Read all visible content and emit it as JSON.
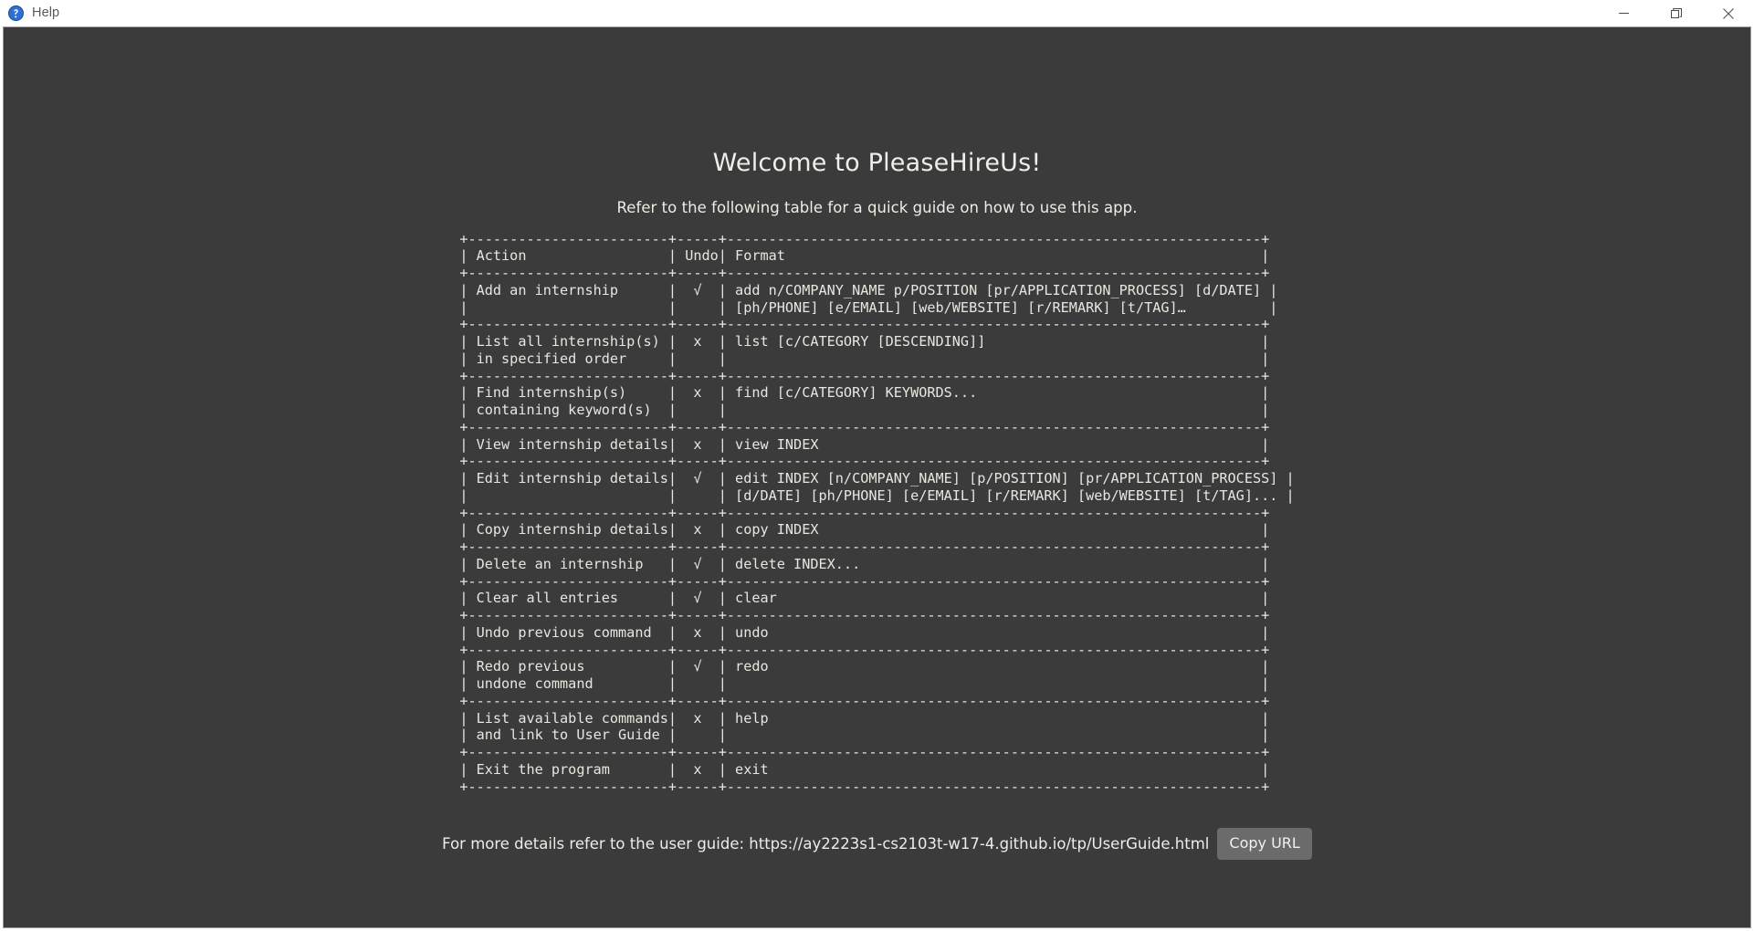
{
  "window": {
    "title": "Help",
    "icon": "help-question-icon",
    "controls": {
      "minimize_label": "Minimize",
      "maximize_label": "Restore",
      "close_label": "Close"
    }
  },
  "help": {
    "title": "Welcome to PleaseHireUs!",
    "subtitle": "Refer to the following table for a quick guide on how to use this app.",
    "footer_text": "For more details refer to the user guide: https://ay2223s1-cs2103t-w17-4.github.io/tp/UserGuide.html",
    "user_guide_url": "https://ay2223s1-cs2103t-w17-4.github.io/tp/UserGuide.html",
    "copy_url_label": "Copy URL"
  },
  "table": {
    "columns": [
      "Action",
      "Undo",
      "Format"
    ],
    "undo_yes_symbol": "√",
    "undo_no_symbol": "x",
    "rows": [
      {
        "action": [
          "Add an internship",
          ""
        ],
        "undo": "√",
        "format": [
          "add n/COMPANY_NAME p/POSITION [pr/APPLICATION_PROCESS] [d/DATE]",
          "[ph/PHONE] [e/EMAIL] [web/WEBSITE] [r/REMARK] [t/TAG]…"
        ]
      },
      {
        "action": [
          "List all internship(s)",
          "in specified order"
        ],
        "undo": "x",
        "format": [
          "list [c/CATEGORY [DESCENDING]]",
          ""
        ]
      },
      {
        "action": [
          "Find internship(s)",
          "containing keyword(s)"
        ],
        "undo": "x",
        "format": [
          "find [c/CATEGORY] KEYWORDS...",
          ""
        ]
      },
      {
        "action": [
          "View internship details"
        ],
        "undo": "x",
        "format": [
          "view INDEX"
        ]
      },
      {
        "action": [
          "Edit internship details",
          ""
        ],
        "undo": "√",
        "format": [
          "edit INDEX [n/COMPANY_NAME] [p/POSITION] [pr/APPLICATION_PROCESS]",
          "[d/DATE] [ph/PHONE] [e/EMAIL] [r/REMARK] [web/WEBSITE] [t/TAG]..."
        ]
      },
      {
        "action": [
          "Copy internship details"
        ],
        "undo": "x",
        "format": [
          "copy INDEX"
        ]
      },
      {
        "action": [
          "Delete an internship"
        ],
        "undo": "√",
        "format": [
          "delete INDEX..."
        ]
      },
      {
        "action": [
          "Clear all entries"
        ],
        "undo": "√",
        "format": [
          "clear"
        ]
      },
      {
        "action": [
          "Undo previous command"
        ],
        "undo": "x",
        "format": [
          "undo"
        ]
      },
      {
        "action": [
          "Redo previous",
          "undone command"
        ],
        "undo": "√",
        "format": [
          "redo",
          ""
        ]
      },
      {
        "action": [
          "List available commands",
          "and link to User Guide"
        ],
        "undo": "x",
        "format": [
          "help",
          ""
        ]
      },
      {
        "action": [
          "Exit the program"
        ],
        "undo": "x",
        "format": [
          "exit"
        ]
      }
    ],
    "ascii": "+------------------------+-----+----------------------------------------------------------------+\n| Action                 | Undo| Format                                                         |\n+------------------------+-----+----------------------------------------------------------------+\n| Add an internship      |  √  | add n/COMPANY_NAME p/POSITION [pr/APPLICATION_PROCESS] [d/DATE] |\n|                        |     | [ph/PHONE] [e/EMAIL] [web/WEBSITE] [r/REMARK] [t/TAG]…          |\n+------------------------+-----+----------------------------------------------------------------+\n| List all internship(s) |  x  | list [c/CATEGORY [DESCENDING]]                                 |\n| in specified order     |     |                                                                |\n+------------------------+-----+----------------------------------------------------------------+\n| Find internship(s)     |  x  | find [c/CATEGORY] KEYWORDS...                                  |\n| containing keyword(s)  |     |                                                                |\n+------------------------+-----+----------------------------------------------------------------+\n| View internship details|  x  | view INDEX                                                     |\n+------------------------+-----+----------------------------------------------------------------+\n| Edit internship details|  √  | edit INDEX [n/COMPANY_NAME] [p/POSITION] [pr/APPLICATION_PROCESS] |\n|                        |     | [d/DATE] [ph/PHONE] [e/EMAIL] [r/REMARK] [web/WEBSITE] [t/TAG]... |\n+------------------------+-----+----------------------------------------------------------------+\n| Copy internship details|  x  | copy INDEX                                                     |\n+------------------------+-----+----------------------------------------------------------------+\n| Delete an internship   |  √  | delete INDEX...                                                |\n+------------------------+-----+----------------------------------------------------------------+\n| Clear all entries      |  √  | clear                                                          |\n+------------------------+-----+----------------------------------------------------------------+\n| Undo previous command  |  x  | undo                                                           |\n+------------------------+-----+----------------------------------------------------------------+\n| Redo previous          |  √  | redo                                                           |\n| undone command         |     |                                                                |\n+------------------------+-----+----------------------------------------------------------------+\n| List available commands|  x  | help                                                           |\n| and link to User Guide |     |                                                                |\n+------------------------+-----+----------------------------------------------------------------+\n| Exit the program       |  x  | exit                                                           |\n+------------------------+-----+----------------------------------------------------------------+"
  }
}
